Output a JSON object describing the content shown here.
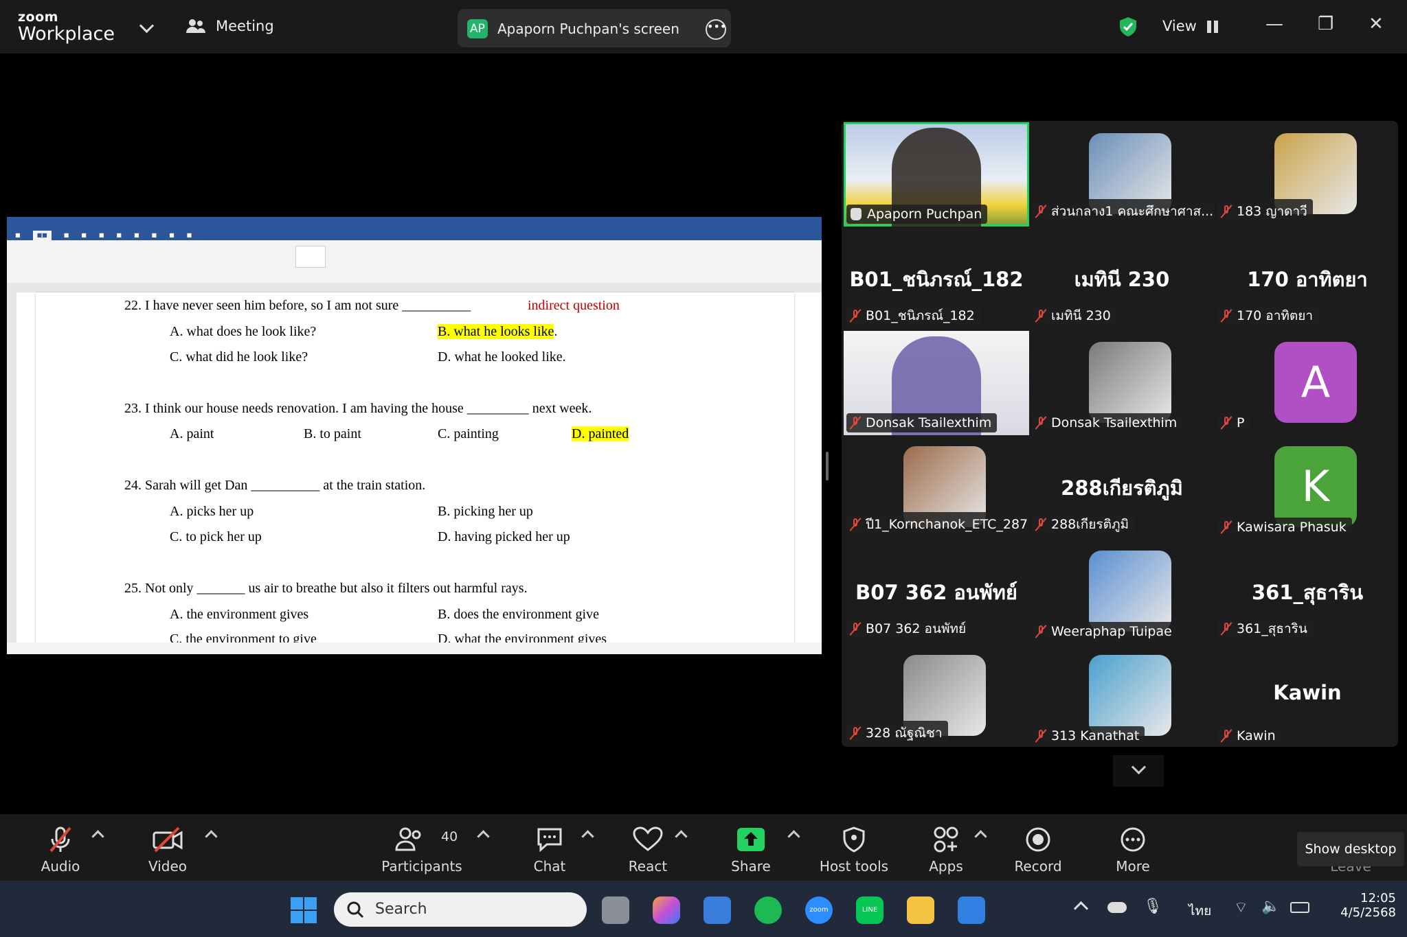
{
  "topbar": {
    "brand_small": "zoom",
    "brand_big": "Workplace",
    "meeting_label": "Meeting",
    "share_badge": "AP",
    "share_title": "Apaporn Puchpan's screen",
    "view_label": "View"
  },
  "document": {
    "questions": [
      {
        "stem": "22. I have never seen him before, so I am not sure __________",
        "note": "indirect question",
        "options": [
          "A. what does he look like?",
          "B. what he looks like",
          "C. what did he look like?",
          "D. what he looked like."
        ],
        "b_suffix": "."
      },
      {
        "stem": "23. I think our house needs renovation. I am having the house _________ next week.",
        "options": [
          "A. paint",
          "B. to paint",
          "C. painting",
          "D. painted"
        ]
      },
      {
        "stem": "24. Sarah will get Dan __________ at the train station.",
        "options": [
          "A. picks her up",
          "B. picking her up",
          "C. to pick her up",
          "D. having picked her up"
        ]
      },
      {
        "stem": "25. Not only _______ us air to breathe but also it filters out harmful rays.",
        "options": [
          "A. the environment gives",
          "B. does the environment give",
          "C. the environment to give",
          "D. what the environment gives"
        ]
      }
    ]
  },
  "gallery": {
    "tiles": [
      {
        "name": "Apaporn Puchpan",
        "kind": "video",
        "active": true,
        "status": "hand"
      },
      {
        "name": "ส่วนกลาง1 คณะศึกษาศาส...",
        "kind": "photo",
        "status": "mic-off"
      },
      {
        "name": "183 ญาดาวี",
        "kind": "photo",
        "status": "mic-off"
      },
      {
        "name": "B01_ชนิภรณ์_182",
        "display": "B01_ชนิภรณ์_182",
        "kind": "text",
        "status": "mic-off"
      },
      {
        "name": "เมทินี 230",
        "display": "เมทินี 230",
        "kind": "text",
        "status": "mic-off"
      },
      {
        "name": "170 อาทิตยา",
        "display": "170 อาทิตยา",
        "kind": "text",
        "status": "mic-off"
      },
      {
        "name": "Donsak Tsailexthim",
        "kind": "video",
        "status": "mic-off"
      },
      {
        "name": "Donsak Tsailexthim",
        "kind": "photo",
        "status": "mic-off"
      },
      {
        "name": "P",
        "kind": "letter",
        "letter": "A",
        "color": "#b14fc5",
        "status": "mic-off"
      },
      {
        "name": "ปี1_Kornchanok_ETC_287",
        "kind": "photo",
        "status": "mic-off"
      },
      {
        "name": "288เกียรติภูมิ",
        "display": "288เกียรติภูมิ",
        "kind": "text",
        "status": "mic-off"
      },
      {
        "name": "Kawisara Phasuk",
        "kind": "letter",
        "letter": "K",
        "color": "#4aa43a",
        "status": "mic-off"
      },
      {
        "name": "B07 362 อนพัทย์",
        "display": "B07 362 อนพัทย์",
        "kind": "text",
        "status": "mic-off"
      },
      {
        "name": "Weeraphap Tuipae",
        "kind": "photo",
        "status": "mic-off"
      },
      {
        "name": "361_สุธาริน",
        "display": "361_สุธาริน",
        "kind": "text",
        "status": "mic-off"
      },
      {
        "name": "328 ณัฐณิชา",
        "kind": "photo",
        "status": "mic-off"
      },
      {
        "name": "313 Kanathat",
        "kind": "photo",
        "status": "mic-off"
      },
      {
        "name": "Kawin",
        "display": "Kawin",
        "kind": "text",
        "status": "mic-off"
      }
    ]
  },
  "toolbar": {
    "audio": "Audio",
    "video": "Video",
    "participants": "Participants",
    "participants_count": "40",
    "chat": "Chat",
    "react": "React",
    "share": "Share",
    "host_tools": "Host tools",
    "apps": "Apps",
    "record": "Record",
    "more": "More",
    "leave": "Leave",
    "tooltip": "Show desktop"
  },
  "taskbar": {
    "search_placeholder": "Search",
    "language": "ไทย",
    "time": "12:05",
    "date": "4/5/2568"
  }
}
